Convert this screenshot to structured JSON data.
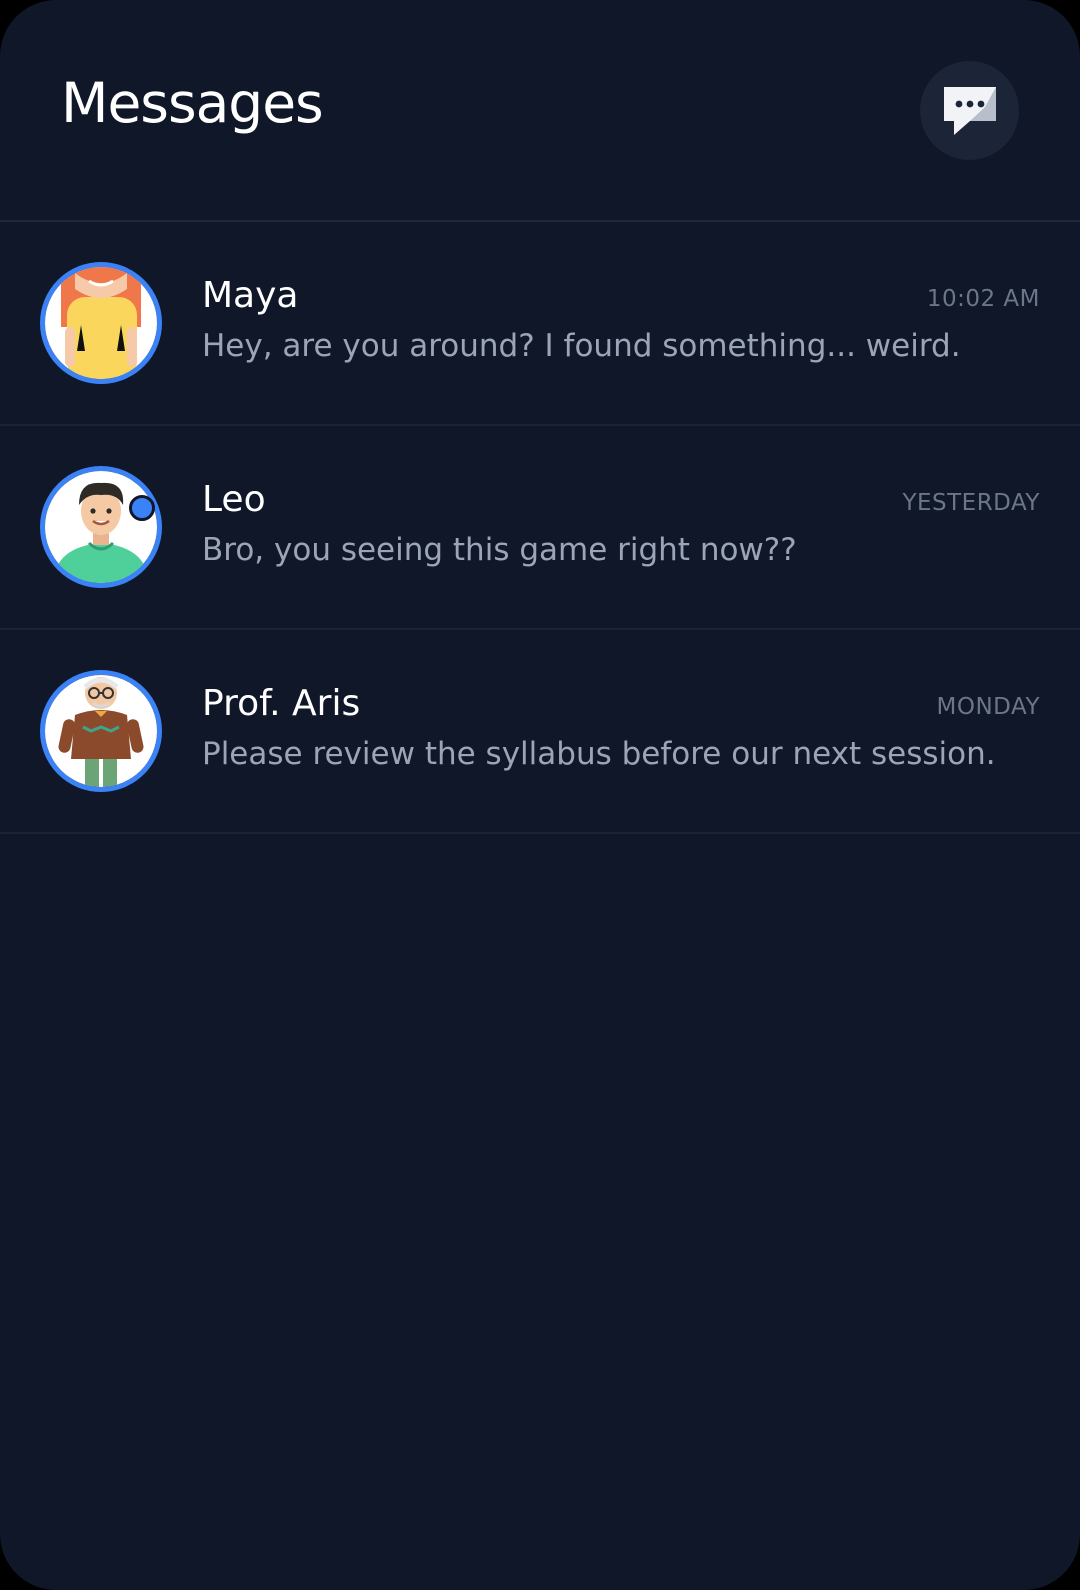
{
  "header": {
    "title": "Messages",
    "compose_icon": "chat-bubble-icon"
  },
  "colors": {
    "background": "#0f1729",
    "accent": "#3b82f6",
    "name": "#ffffff",
    "preview": "#9ba5b7",
    "time": "#6b7689"
  },
  "conversations": [
    {
      "name": "Maya",
      "time": "10:02 AM",
      "preview": "Hey, are you around? I found something... weird.",
      "avatar_icon": "maya-avatar",
      "online": true
    },
    {
      "name": "Leo",
      "time": "YESTERDAY",
      "preview": "Bro, you seeing this game right now??",
      "avatar_icon": "leo-avatar",
      "online": false
    },
    {
      "name": "Prof. Aris",
      "time": "MONDAY",
      "preview": "Please review the syllabus before our next session.",
      "avatar_icon": "prof-aris-avatar",
      "online": false
    }
  ]
}
